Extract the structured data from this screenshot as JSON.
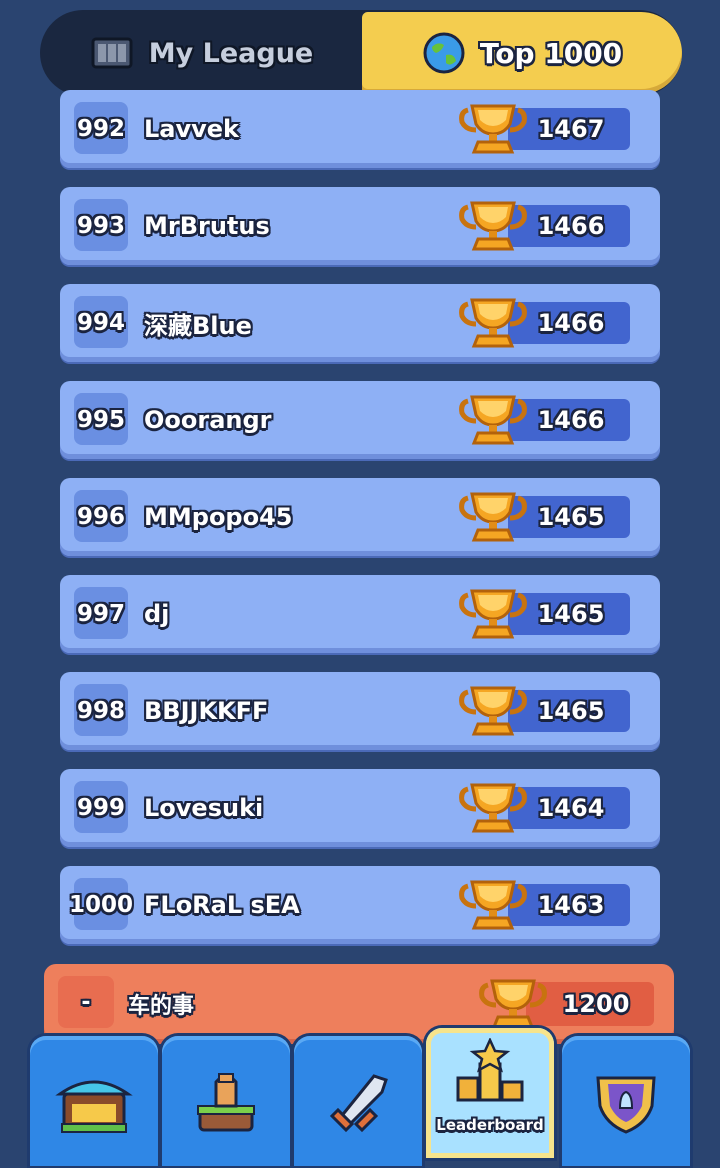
{
  "tabs": {
    "my_league": "My League",
    "top": "Top 1000"
  },
  "rows": [
    {
      "rank": "992",
      "name": "Lavvek",
      "score": "1467"
    },
    {
      "rank": "993",
      "name": "MrBrutus",
      "score": "1466"
    },
    {
      "rank": "994",
      "name": "深藏Blue",
      "score": "1466"
    },
    {
      "rank": "995",
      "name": "Ooorangr",
      "score": "1466"
    },
    {
      "rank": "996",
      "name": "MMpopo45",
      "score": "1465"
    },
    {
      "rank": "997",
      "name": "dj",
      "score": "1465"
    },
    {
      "rank": "998",
      "name": "BBJJKKFF",
      "score": "1465"
    },
    {
      "rank": "999",
      "name": "Lovesuki",
      "score": "1464"
    },
    {
      "rank": "1000",
      "name": "FLoRaL sEA",
      "score": "1463"
    }
  ],
  "me": {
    "rank": "-",
    "name": "车的事",
    "score": "1200"
  },
  "nav": {
    "items": [
      {
        "name": "shop-icon"
      },
      {
        "name": "cards-icon"
      },
      {
        "name": "battle-icon"
      },
      {
        "name": "leaderboard-icon",
        "label": "Leaderboard"
      },
      {
        "name": "clan-icon"
      }
    ]
  },
  "colors": {
    "accent": "#f4cd4f",
    "row": "#8eb0f5",
    "me_row": "#ee7f5c"
  }
}
